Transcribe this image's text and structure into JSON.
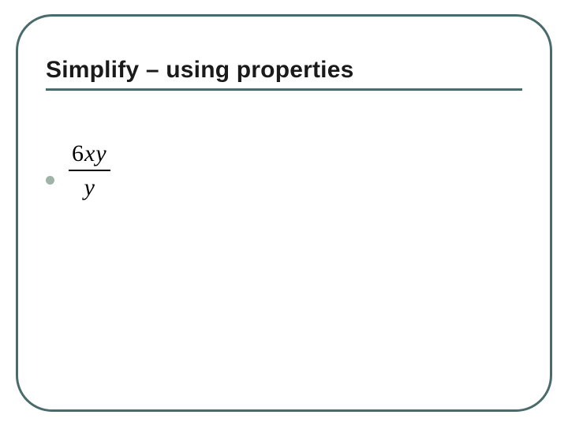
{
  "slide": {
    "title": "Simplify – using properties",
    "expression": {
      "coefficient": "6",
      "numerator_vars": "xy",
      "denominator": "y"
    }
  }
}
